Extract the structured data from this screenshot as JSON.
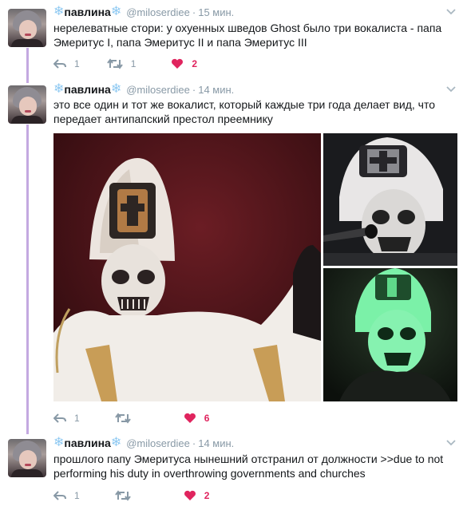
{
  "tweets": [
    {
      "name": "павлина",
      "name_prefix": "❄",
      "name_suffix": "❄",
      "handle": "@miloserdiee",
      "time": "15 мин.",
      "text": "нерелеватные стори: у охуенных шведов Ghost было три вокалиста - папа Эмеритус I, папа Эмеритус II и папа Эмеритус III",
      "reply_count": "1",
      "retweet_count": "1",
      "like_count": "2"
    },
    {
      "name": "павлина",
      "name_prefix": "❄",
      "name_suffix": "❄",
      "handle": "@miloserdiee",
      "time": "14 мин.",
      "text": "это все один и тот же вокалист, который каждые три года делает вид, что передает антипапский престол преемнику",
      "reply_count": "1",
      "retweet_count": "",
      "like_count": "6"
    },
    {
      "name": "павлина",
      "name_prefix": "❄",
      "name_suffix": "❄",
      "handle": "@miloserdiee",
      "time": "14 мин.",
      "text": "прошлого папу Эмеритуса нынешний отстранил от должности >>due to not performing his duty in overthrowing governments and churches",
      "reply_count": "1",
      "retweet_count": "",
      "like_count": "2"
    }
  ],
  "colors": {
    "thread_line": "#c4a9e0",
    "like_red": "#e0245e",
    "muted": "#8899a6",
    "snowflake": "#8ec9f2"
  },
  "icons": [
    "reply-icon",
    "retweet-icon",
    "heart-icon",
    "chevron-down-icon",
    "snowflake-icon"
  ]
}
